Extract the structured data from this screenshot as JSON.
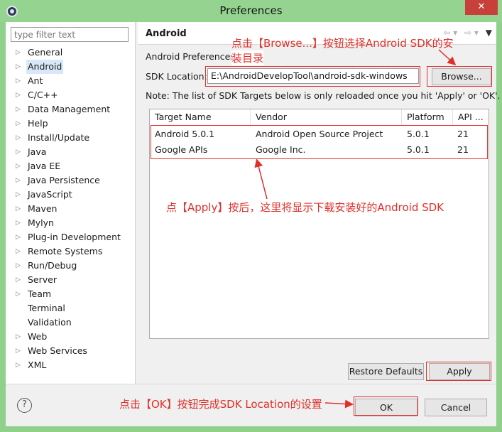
{
  "window": {
    "title": "Preferences",
    "close_label": "✕"
  },
  "filter": {
    "placeholder": "type filter text"
  },
  "tree": [
    {
      "label": "General",
      "expandable": true
    },
    {
      "label": "Android",
      "expandable": true,
      "selected": true
    },
    {
      "label": "Ant",
      "expandable": true
    },
    {
      "label": "C/C++",
      "expandable": true
    },
    {
      "label": "Data Management",
      "expandable": true
    },
    {
      "label": "Help",
      "expandable": true
    },
    {
      "label": "Install/Update",
      "expandable": true
    },
    {
      "label": "Java",
      "expandable": true
    },
    {
      "label": "Java EE",
      "expandable": true
    },
    {
      "label": "Java Persistence",
      "expandable": true
    },
    {
      "label": "JavaScript",
      "expandable": true
    },
    {
      "label": "Maven",
      "expandable": true
    },
    {
      "label": "Mylyn",
      "expandable": true
    },
    {
      "label": "Plug-in Development",
      "expandable": true
    },
    {
      "label": "Remote Systems",
      "expandable": true
    },
    {
      "label": "Run/Debug",
      "expandable": true
    },
    {
      "label": "Server",
      "expandable": true
    },
    {
      "label": "Team",
      "expandable": true
    },
    {
      "label": "Terminal",
      "expandable": false
    },
    {
      "label": "Validation",
      "expandable": false
    },
    {
      "label": "Web",
      "expandable": true
    },
    {
      "label": "Web Services",
      "expandable": true
    },
    {
      "label": "XML",
      "expandable": true
    }
  ],
  "page": {
    "title": "Android",
    "preferences_label": "Android Preferences",
    "sdk_location_label": "SDK Location:",
    "sdk_location_value": "E:\\AndroidDevelopTool\\android-sdk-windows",
    "browse_label": "Browse...",
    "note": "Note: The list of SDK Targets below is only reloaded once you hit 'Apply' or 'OK'.",
    "table": {
      "headers": [
        "Target Name",
        "Vendor",
        "Platform",
        "API ..."
      ],
      "rows": [
        [
          "Android 5.0.1",
          "Android Open Source Project",
          "5.0.1",
          "21"
        ],
        [
          "Google APIs",
          "Google Inc.",
          "5.0.1",
          "21"
        ]
      ]
    },
    "restore_defaults_label": "Restore Defaults",
    "apply_label": "Apply"
  },
  "footer": {
    "help_label": "?",
    "ok_label": "OK",
    "cancel_label": "Cancel"
  },
  "annotations": {
    "browse_line1": "点击【Browse...】按钮选择Android SDK的安",
    "browse_line2": "装目录",
    "apply_note": "点【Apply】按后，这里将显示下载安装好的Android SDK",
    "ok_note": "点击【OK】按钮完成SDK Location的设置"
  },
  "icons": {
    "nav_back": "back-arrow-icon",
    "nav_forward": "forward-arrow-icon",
    "view_menu": "view-menu-icon",
    "help": "help-icon"
  },
  "colors": {
    "frame": "#8fd08a",
    "annotation": "#e0302a",
    "selection": "#d9e8f9"
  }
}
